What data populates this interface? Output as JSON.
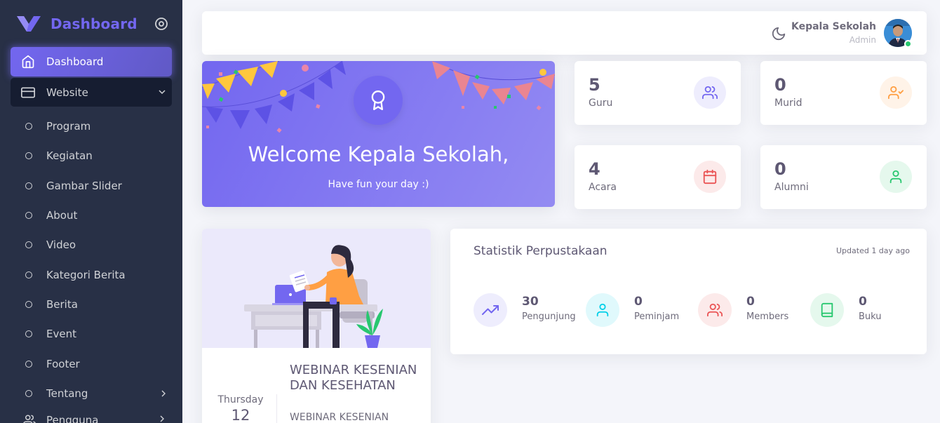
{
  "sidebar": {
    "brand": "Dashboard",
    "active_item": {
      "label": "Dashboard",
      "icon": "home-icon"
    },
    "group_item": {
      "label": "Website",
      "icon": "credit-card-icon"
    },
    "sub_items": [
      {
        "label": "Program"
      },
      {
        "label": "Kegiatan"
      },
      {
        "label": "Gambar Slider"
      },
      {
        "label": "About"
      },
      {
        "label": "Video"
      },
      {
        "label": "Kategori Berita"
      },
      {
        "label": "Berita"
      },
      {
        "label": "Event"
      },
      {
        "label": "Footer"
      },
      {
        "label": "Tentang"
      }
    ],
    "users_item": {
      "label": "Pengguna",
      "icon": "users-icon"
    }
  },
  "navbar": {
    "user_name": "Kepala Sekolah",
    "user_role": "Admin"
  },
  "welcome": {
    "title": "Welcome Kepala Sekolah,",
    "subtitle": "Have fun your day :)"
  },
  "stats_cards": [
    {
      "value": "5",
      "label": "Guru",
      "icon": "users-icon",
      "color": "#7367f0"
    },
    {
      "value": "0",
      "label": "Murid",
      "icon": "user-check-icon",
      "color": "#ff9f43"
    },
    {
      "value": "4",
      "label": "Acara",
      "icon": "calendar-icon",
      "color": "#ea5455"
    },
    {
      "value": "0",
      "label": "Alumni",
      "icon": "user-icon",
      "color": "#28c76f"
    }
  ],
  "event": {
    "day": "Thursday",
    "date": "12",
    "title": "WEBINAR KESENIAN DAN KESEHATAN",
    "description": "WEBINAR KESENIAN"
  },
  "library_stats": {
    "title": "Statistik Perpustakaan",
    "updated": "Updated 1 day ago",
    "items": [
      {
        "value": "30",
        "label": "Pengunjung",
        "icon": "trending-up-icon",
        "color": "#7367f0"
      },
      {
        "value": "0",
        "label": "Peminjam",
        "icon": "user-icon",
        "color": "#00cfe8"
      },
      {
        "value": "0",
        "label": "Members",
        "icon": "users-icon",
        "color": "#ea5455"
      },
      {
        "value": "0",
        "label": "Buku",
        "icon": "book-icon",
        "color": "#28c76f"
      }
    ]
  },
  "colors": {
    "primary": "#7367f0",
    "sidebar_bg": "#283046",
    "page_bg": "#f4f5fa"
  }
}
